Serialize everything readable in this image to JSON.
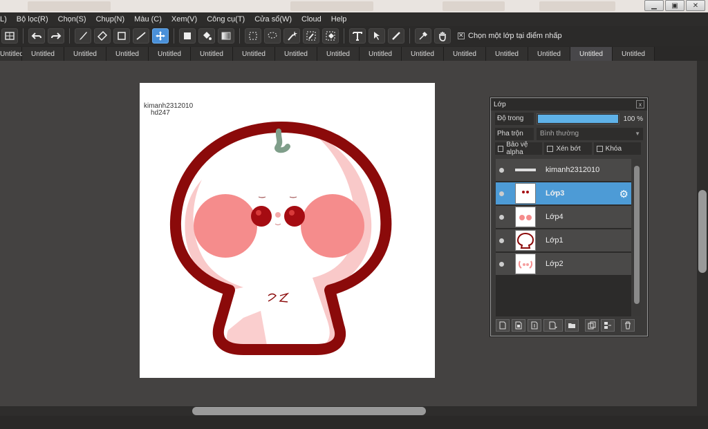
{
  "window_buttons": [
    "▁",
    "▣",
    "✕"
  ],
  "menu": [
    "L)",
    "Bộ lọc(R)",
    "Chọn(S)",
    "Chụp(N)",
    "Màu (C)",
    "Xem(V)",
    "Công cụ(T)",
    "Cửa sổ(W)",
    "Cloud",
    "Help"
  ],
  "toolbar": {
    "option_label": "Chọn một lớp tại điểm nhấp",
    "option_checked": true
  },
  "tabs": [
    "Untitled",
    "Untitled",
    "Untitled",
    "Untitled",
    "Untitled",
    "Untitled",
    "Untitled",
    "Untitled",
    "Untitled",
    "Untitled",
    "Untitled",
    "Untitled",
    "Untitled",
    "Untitled",
    "Untitled",
    "Untitled"
  ],
  "active_tab_index": 14,
  "canvas": {
    "signature_line1": "kimanh2312010",
    "signature_line2": "hd247"
  },
  "layers_panel": {
    "title": "Lớp",
    "close": "x",
    "opacity_label": "Độ trong",
    "opacity_value": "100 %",
    "opacity_fraction": 1.0,
    "blend_label": "Pha trộn",
    "blend_value": "Bình thường",
    "protect_alpha": "Bảo vệ alpha",
    "clipping": "Xén bớt",
    "lock": "Khóa",
    "layers": [
      {
        "name": "kimanh2312010",
        "selected": false
      },
      {
        "name": "Lớp3",
        "selected": true
      },
      {
        "name": "Lớp4",
        "selected": false
      },
      {
        "name": "Lớp1",
        "selected": false
      },
      {
        "name": "Lớp2",
        "selected": false
      }
    ]
  },
  "colors": {
    "accent": "#4d9bd6",
    "outline": "#8b0a0a",
    "cheek": "#f58c8c",
    "inner_pink": "#f9c9c9"
  }
}
